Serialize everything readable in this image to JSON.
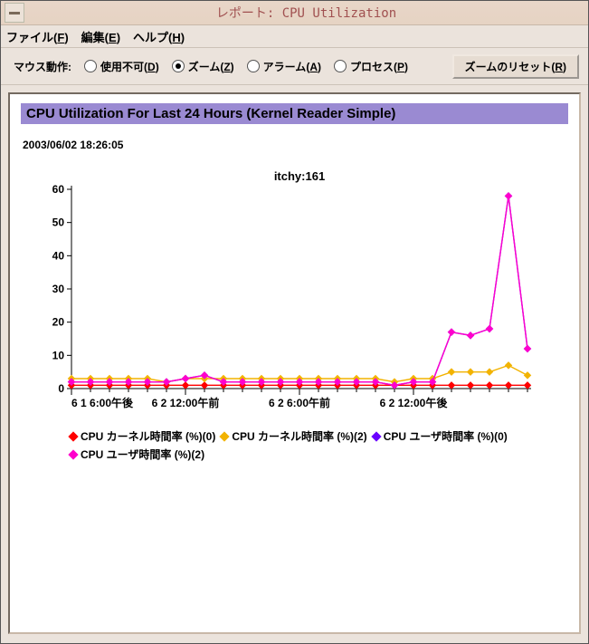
{
  "window": {
    "title": "レポート: CPU Utilization"
  },
  "menubar": {
    "file": "ファイル",
    "file_u": "F",
    "edit": "編集",
    "edit_u": "E",
    "help": "ヘルプ",
    "help_u": "H"
  },
  "toolbar": {
    "mouse_label": "マウス動作:",
    "opt_disable": "使用不可",
    "opt_disable_u": "D",
    "opt_zoom": "ズーム",
    "opt_zoom_u": "Z",
    "opt_alarm": "アラーム",
    "opt_alarm_u": "A",
    "opt_process": "プロセス",
    "opt_process_u": "P",
    "selected": "zoom",
    "reset_label": "ズームのリセット",
    "reset_u": "R"
  },
  "report": {
    "banner": "CPU Utilization For Last 24 Hours (Kernel Reader Simple)",
    "timestamp": "2003/06/02 18:26:05"
  },
  "chart_data": {
    "type": "line",
    "title": "itchy:161",
    "ylabel": "",
    "xlabel": "",
    "ylim": [
      0,
      60
    ],
    "yticks": [
      0,
      10,
      20,
      30,
      40,
      50,
      60
    ],
    "xtick_labels": [
      "6 1 6:00午後",
      "6 2 12:00午前",
      "6 2 6:00午前",
      "6 2 12:00午後"
    ],
    "xtick_idx": [
      0,
      6,
      12,
      18
    ],
    "n_points": 25,
    "series": [
      {
        "name": "CPU カーネル時間率 (%)(0)",
        "color": "#ff0000",
        "values": [
          1,
          1,
          1,
          1,
          1,
          1,
          1,
          1,
          1,
          1,
          1,
          1,
          1,
          1,
          1,
          1,
          1,
          1,
          1,
          1,
          1,
          1,
          1,
          1,
          1
        ]
      },
      {
        "name": "CPU カーネル時間率 (%)(2)",
        "color": "#f2b300",
        "values": [
          3,
          3,
          3,
          3,
          3,
          2,
          3,
          3,
          3,
          3,
          3,
          3,
          3,
          3,
          3,
          3,
          3,
          2,
          3,
          3,
          5,
          5,
          5,
          7,
          4
        ]
      },
      {
        "name": "CPU ユーザ時間率 (%)(0)",
        "color": "#6a00ff",
        "values": [
          2,
          2,
          2,
          2,
          2,
          2,
          3,
          4,
          2,
          2,
          2,
          2,
          2,
          2,
          2,
          2,
          2,
          1,
          2,
          2,
          17,
          16,
          18,
          58,
          12
        ]
      },
      {
        "name": "CPU ユーザ時間率 (%)(2)",
        "color": "#ff00cc",
        "values": [
          2,
          2,
          2,
          2,
          2,
          2,
          3,
          4,
          2,
          2,
          2,
          2,
          2,
          2,
          2,
          2,
          2,
          1,
          2,
          2,
          17,
          16,
          18,
          58,
          12
        ]
      }
    ]
  }
}
